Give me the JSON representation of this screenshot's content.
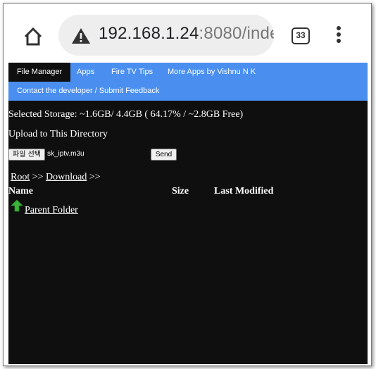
{
  "browser": {
    "url_host": "192.168.1.24",
    "url_rest": ":8080/inde",
    "tab_count": "33",
    "icons": [
      "home-icon",
      "warning-icon",
      "tabs-icon",
      "more-vert-icon"
    ]
  },
  "nav": {
    "items": [
      "File Manager",
      "Apps",
      "Fire TV Tips",
      "More Apps by Vishnu N K",
      "Contact the developer / Submit Feedback"
    ],
    "accent_color": "#4a8ff0"
  },
  "storage_text": "Selected Storage: ~1.6GB/ 4.4GB ( 64.17% / ~2.8GB Free)",
  "upload": {
    "title": "Upload to This Directory",
    "choose_label": "파일 선택",
    "file_name": "sk_iptv.m3u",
    "send_label": "Send"
  },
  "breadcrumb": {
    "root": "Root",
    "sep1": " >> ",
    "download": "Download",
    "sep2": " >>"
  },
  "table": {
    "headers": [
      "Name",
      "Size",
      "Last Modified"
    ],
    "parent_label": "Parent Folder"
  }
}
